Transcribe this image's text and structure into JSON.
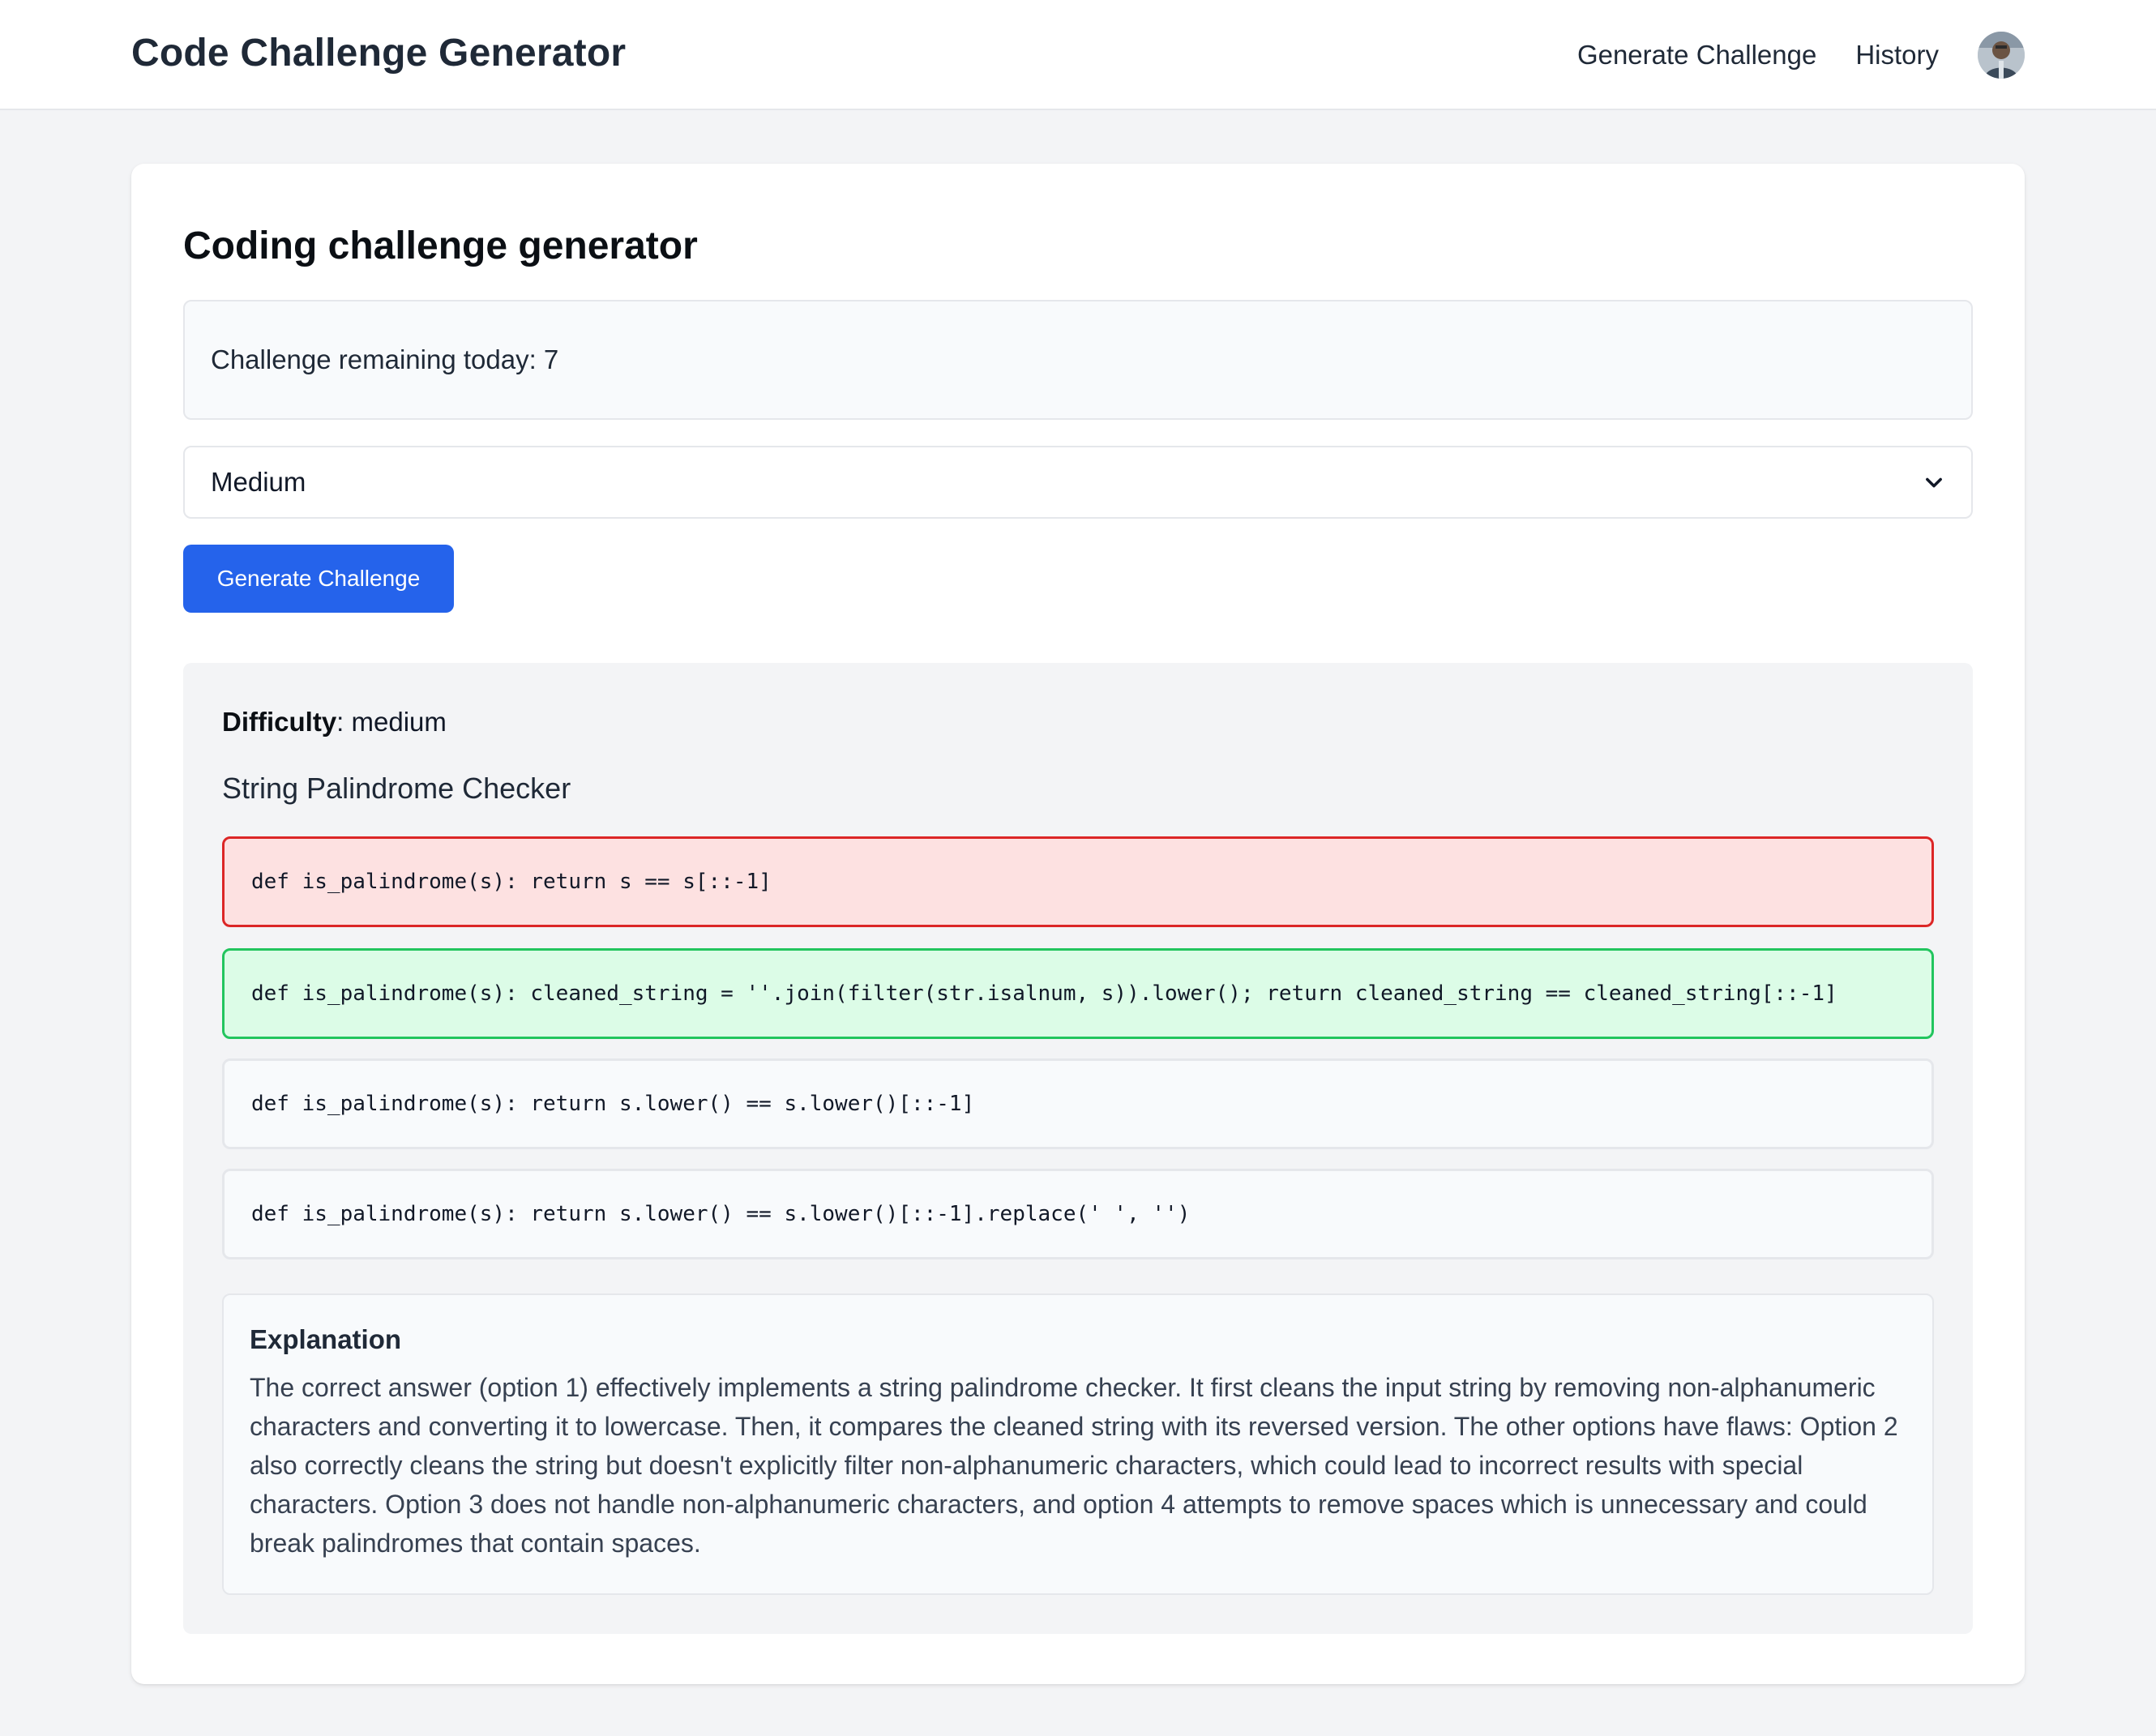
{
  "header": {
    "brand": "Code Challenge Generator",
    "nav": {
      "generate": "Generate Challenge",
      "history": "History"
    }
  },
  "main": {
    "title": "Coding challenge generator",
    "quota_text": "Challenge remaining today: 7",
    "difficulty_select": {
      "selected": "Medium"
    },
    "generate_button": "Generate Challenge"
  },
  "challenge": {
    "difficulty_label": "Difficulty",
    "difficulty_value": ": medium",
    "title": "String Palindrome Checker",
    "options": [
      {
        "code": "def is_palindrome(s): return s == s[::-1]",
        "state": "wrong"
      },
      {
        "code": "def is_palindrome(s): cleaned_string = ''.join(filter(str.isalnum, s)).lower(); return cleaned_string == cleaned_string[::-1]",
        "state": "correct"
      },
      {
        "code": "def is_palindrome(s): return s.lower() == s.lower()[::-1]",
        "state": "neutral"
      },
      {
        "code": "def is_palindrome(s): return s.lower() == s.lower()[::-1].replace(' ', '')",
        "state": "neutral"
      }
    ],
    "explanation_heading": "Explanation",
    "explanation_text": "The correct answer (option 1) effectively implements a string palindrome checker. It first cleans the input string by removing non-alphanumeric characters and converting it to lowercase. Then, it compares the cleaned string with its reversed version. The other options have flaws: Option 2 also correctly cleans the string but doesn't explicitly filter non-alphanumeric characters, which could lead to incorrect results with special characters. Option 3 does not handle non-alphanumeric characters, and option 4 attempts to remove spaces which is unnecessary and could break palindromes that contain spaces."
  },
  "colors": {
    "primary": "#2563eb",
    "wrong_bg": "#fde1e1",
    "wrong_border": "#dc2626",
    "correct_bg": "#dcfce7",
    "correct_border": "#22c55e"
  }
}
